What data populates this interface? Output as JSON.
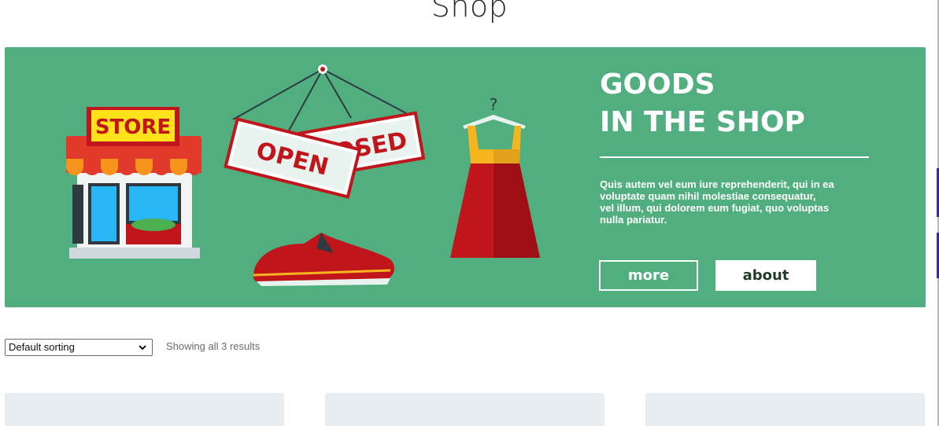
{
  "page": {
    "title": "Shop"
  },
  "banner": {
    "heading_line1": "GOODS",
    "heading_line2": "IN THE SHOP",
    "text_lines": [
      "Quis autem vel eum iure reprehenderit, qui in ea",
      "voluptate quam nihil molestiae consequatur,",
      "vel illum, qui dolorem eum fugiat, quo voluptas",
      "nulla pariatur."
    ],
    "more_label": "more",
    "about_label": "about",
    "illustration": {
      "store_sign": "STORE",
      "open_sign": "OPEN",
      "closed_sign_visible": "OSED",
      "hanger_mark": "?"
    },
    "colors": {
      "background": "#51af7f",
      "awning_red": "#e23a2a",
      "sign_yellow": "#ffe21a",
      "dress_red": "#c0161b",
      "dress_top": "#f6b51f"
    }
  },
  "toolbar": {
    "sort_selected": "Default sorting",
    "result_count": "Showing all 3 results"
  },
  "products": {
    "card_color": "#e8edf1",
    "count": 3
  },
  "icons": {
    "sort_dropdown": "chevron-down-icon"
  }
}
